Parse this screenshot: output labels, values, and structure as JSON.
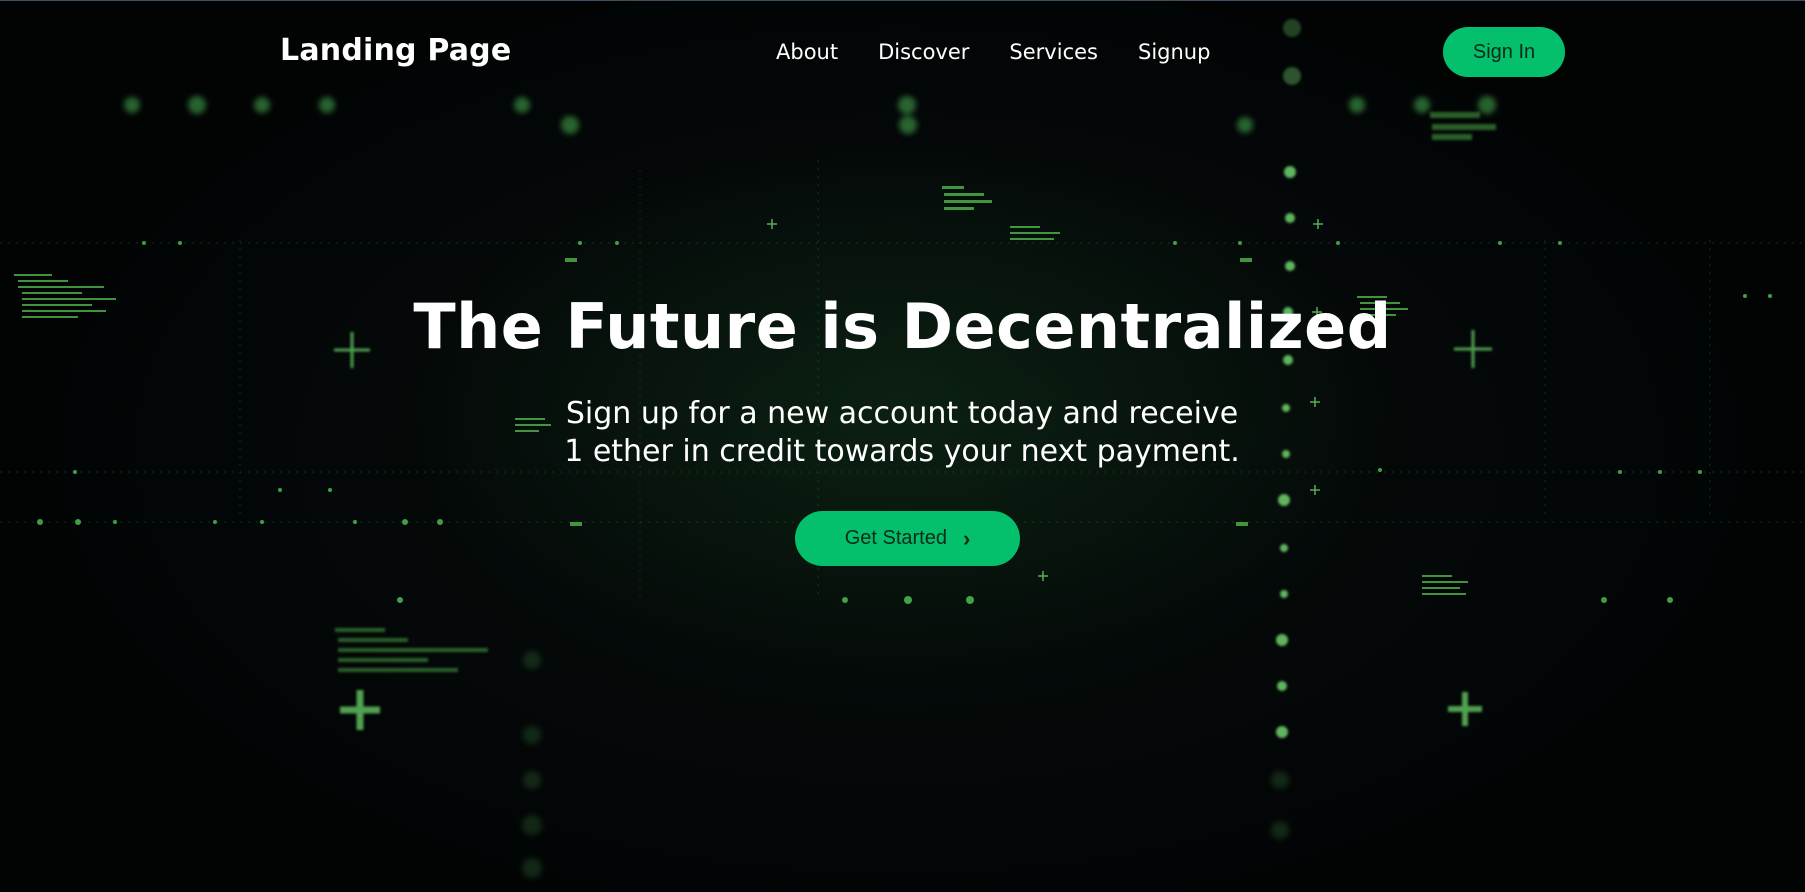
{
  "navbar": {
    "brand": "Landing Page",
    "links": [
      "About",
      "Discover",
      "Services",
      "Signup"
    ],
    "signin_label": "Sign In"
  },
  "hero": {
    "title": "The Future is Decentralized",
    "subtitle": "Sign up for a new account today and receive 1 ether in credit towards your next payment.",
    "cta_label": "Get Started",
    "cta_icon": "chevron-right-icon"
  },
  "colors": {
    "accent": "#04c06c",
    "background": "#05090a",
    "glow": "#3fd15a",
    "text": "#ffffff"
  }
}
